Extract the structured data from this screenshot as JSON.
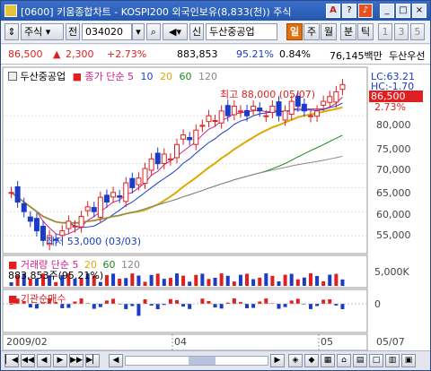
{
  "window": {
    "title": "[0600] 키움종합차트 - KOSPI200 외국인보유(8,833(천)) 주식",
    "buttons": [
      "A",
      "?",
      "_",
      "□",
      "×"
    ]
  },
  "toolbar": {
    "type": "주식",
    "prev": "전",
    "code": "034020",
    "stock_name": "두산중공업",
    "period_tabs": [
      "일",
      "주",
      "월",
      "분",
      "틱"
    ],
    "numbers": [
      "1",
      "3",
      "5"
    ],
    "selected_tab": "일"
  },
  "quote": {
    "price": "86,500",
    "change_arrow": "▲",
    "change": "2,300",
    "change_pct": "+2.73%",
    "volume": "883,853",
    "ratio1": "95.21%",
    "ratio2": "0.84%",
    "amount": "76,145백만",
    "group": "두산우선"
  },
  "chart": {
    "legend_name": "두산중공업",
    "legend_ma_label": "종가 단순",
    "ma_periods": [
      "5",
      "10",
      "20",
      "60",
      "120"
    ],
    "high_label": "최고 88,000 (05/07)",
    "low_label": "최저 53,000 (03/03)",
    "lc": "LC:63.21",
    "hc": "HC:-1.70",
    "current_price": "86,500",
    "current_pct": "2.73%",
    "price_ticks": [
      "80,000",
      "75,000",
      "70,000",
      "65,000",
      "60,000",
      "55,000"
    ],
    "volume_legend_label": "거래량 단순",
    "volume_ma_periods": [
      "5",
      "20",
      "60",
      "120"
    ],
    "volume_value": "883,853주(95.21%)",
    "volume_tick": "5,000K",
    "inst_legend": "기관순매수",
    "inst_tick": "0",
    "date_labels": [
      "2009/02",
      "04",
      "05",
      "05/07"
    ]
  },
  "colors": {
    "up": "#e02020",
    "down": "#1a3cc8",
    "ma5": "#d0208a",
    "ma10": "#1a3cc8",
    "ma20": "#e0a800",
    "ma60": "#1a8a1a",
    "ma120": "#888888"
  },
  "chart_data": {
    "type": "candlestick",
    "title": "두산중공업",
    "ylim": [
      52000,
      89000
    ],
    "high": 88000,
    "low": 53000,
    "last": 86500
  }
}
